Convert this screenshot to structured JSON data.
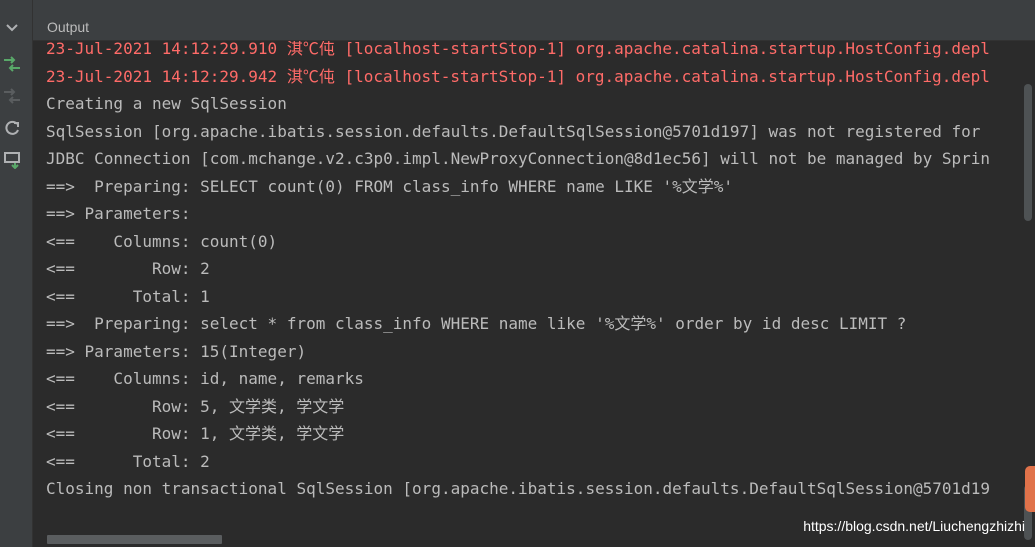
{
  "header": {
    "title": "Output"
  },
  "toolbar": {
    "icons": [
      "collapse-chevron-icon",
      "redeploy-icon",
      "update-resources-icon",
      "restart-icon",
      "dump-threads-icon"
    ]
  },
  "log_lines": [
    {
      "text": "23-Jul-2021 14:12:29.910 淇℃伅 [localhost-startStop-1] org.apache.catalina.startup.HostConfig.depl",
      "kind": "error"
    },
    {
      "text": "23-Jul-2021 14:12:29.942 淇℃伅 [localhost-startStop-1] org.apache.catalina.startup.HostConfig.depl",
      "kind": "error"
    },
    {
      "text": "Creating a new SqlSession",
      "kind": "info"
    },
    {
      "text": "SqlSession [org.apache.ibatis.session.defaults.DefaultSqlSession@5701d197] was not registered for",
      "kind": "info"
    },
    {
      "text": "JDBC Connection [com.mchange.v2.c3p0.impl.NewProxyConnection@8d1ec56] will not be managed by Sprin",
      "kind": "info"
    },
    {
      "text": "==>  Preparing: SELECT count(0) FROM class_info WHERE name LIKE '%文学%'",
      "kind": "info"
    },
    {
      "text": "==> Parameters: ",
      "kind": "info"
    },
    {
      "text": "<==    Columns: count(0)",
      "kind": "info"
    },
    {
      "text": "<==        Row: 2",
      "kind": "info"
    },
    {
      "text": "<==      Total: 1",
      "kind": "info"
    },
    {
      "text": "==>  Preparing: select * from class_info WHERE name like '%文学%' order by id desc LIMIT ?",
      "kind": "info"
    },
    {
      "text": "==> Parameters: 15(Integer)",
      "kind": "info"
    },
    {
      "text": "<==    Columns: id, name, remarks",
      "kind": "info"
    },
    {
      "text": "<==        Row: 5, 文学类, 学文学",
      "kind": "info"
    },
    {
      "text": "<==        Row: 1, 文学类, 学文学",
      "kind": "info"
    },
    {
      "text": "<==      Total: 2",
      "kind": "info"
    },
    {
      "text": "Closing non transactional SqlSession [org.apache.ibatis.session.defaults.DefaultSqlSession@5701d19",
      "kind": "info"
    }
  ],
  "watermark": "https://blog.csdn.net/Liuchengzhizhi",
  "colors": {
    "background": "#2b2b2b",
    "panel": "#3c3f41",
    "text": "#bbbbbb",
    "error_text": "#ff6b68",
    "accent_green": "#59a869"
  }
}
